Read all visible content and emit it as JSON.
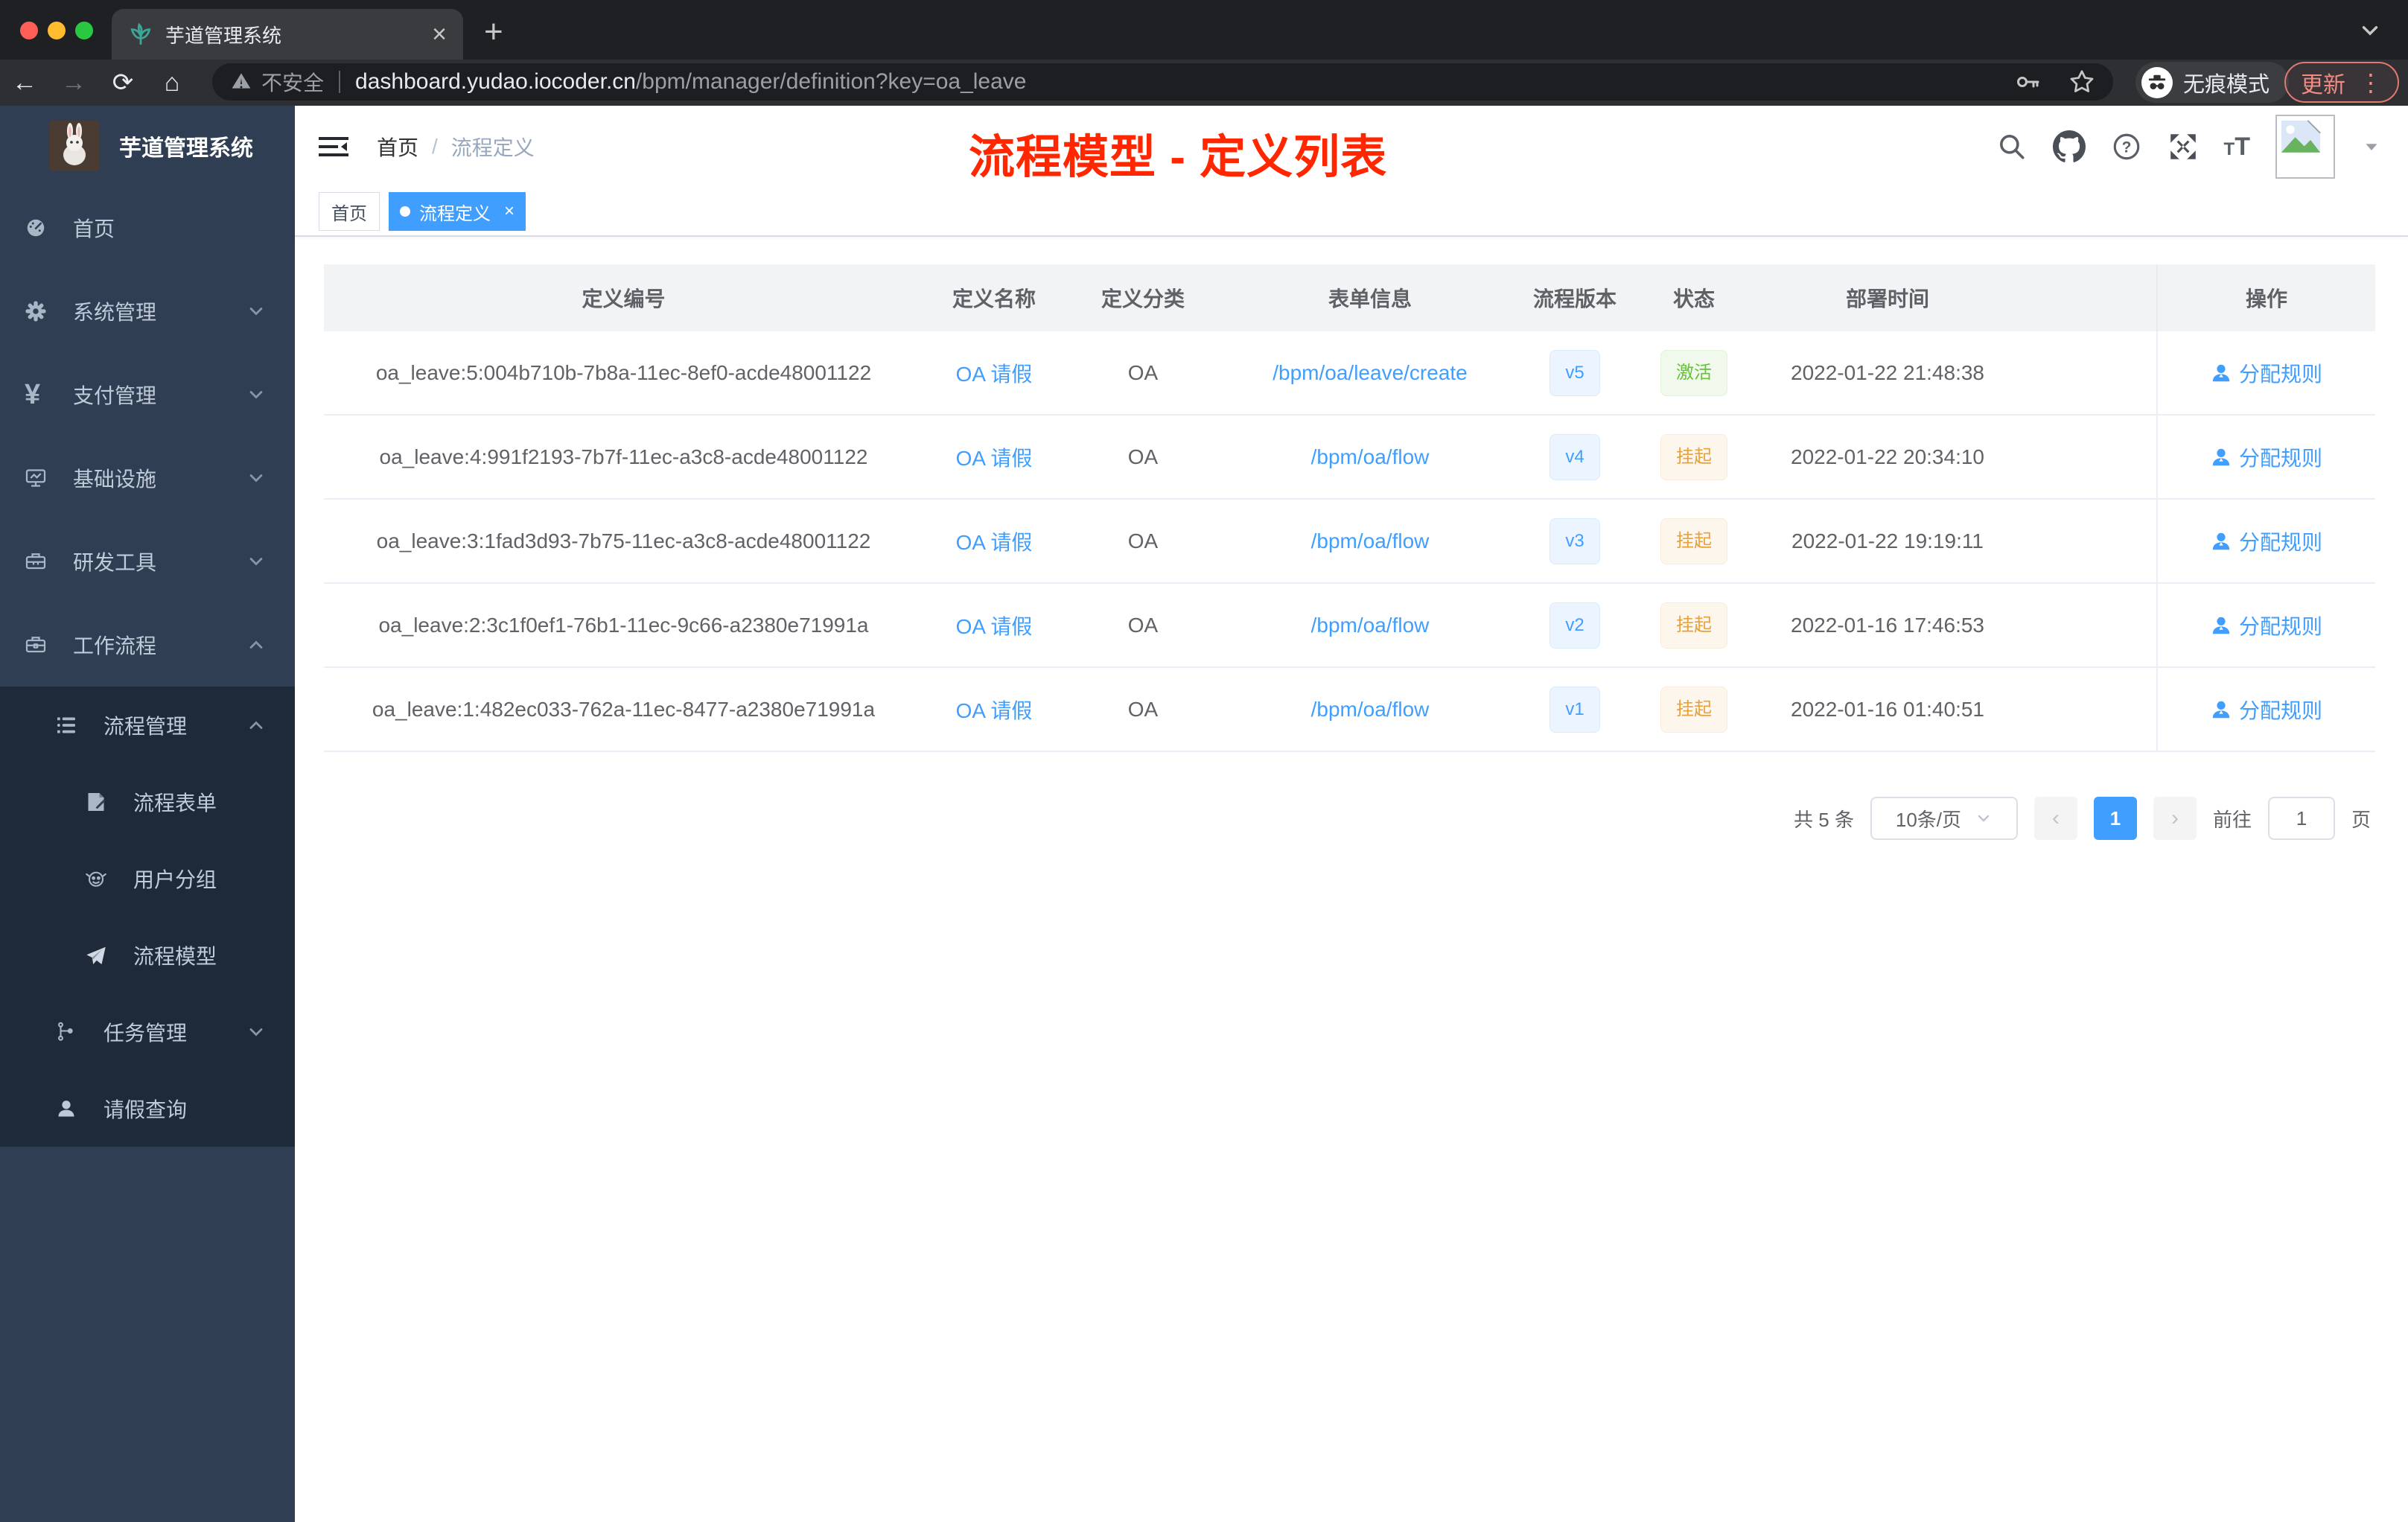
{
  "browser": {
    "tab_title": "芋道管理系统",
    "security_label": "不安全",
    "url_host": "dashboard.yudao.iocoder.cn",
    "url_path": "/bpm/manager/definition?key=oa_leave",
    "incognito_label": "无痕模式",
    "update_label": "更新"
  },
  "glyphs": {
    "close": "×",
    "plus": "+",
    "kebab": "⋮",
    "prev": "‹",
    "next": "›",
    "slash": "/",
    "question": "?",
    "tt_small": "T",
    "tt_big": "T"
  },
  "annotation": {
    "text": "流程模型 - 定义列表",
    "color": "#ff2600"
  },
  "sidebar": {
    "title": "芋道管理系统",
    "items": [
      {
        "label": "首页",
        "icon": "dashboard-icon"
      },
      {
        "label": "系统管理",
        "icon": "gear-icon"
      },
      {
        "label": "支付管理",
        "icon": "yen-icon"
      },
      {
        "label": "基础设施",
        "icon": "monitor-icon"
      },
      {
        "label": "研发工具",
        "icon": "toolbox-icon"
      },
      {
        "label": "工作流程",
        "icon": "briefcase-icon"
      }
    ],
    "submenu": [
      {
        "label": "流程管理",
        "icon": "list-icon"
      },
      {
        "label": "流程表单",
        "icon": "form-icon"
      },
      {
        "label": "用户分组",
        "icon": "robot-icon"
      },
      {
        "label": "流程模型",
        "icon": "paper-plane-icon"
      },
      {
        "label": "任务管理",
        "icon": "flow-icon"
      },
      {
        "label": "请假查询",
        "icon": "user-icon"
      }
    ]
  },
  "header": {
    "breadcrumb": [
      "首页",
      "流程定义"
    ]
  },
  "tags": [
    {
      "label": "首页",
      "active": false
    },
    {
      "label": "流程定义",
      "active": true
    }
  ],
  "table": {
    "columns": [
      "定义编号",
      "定义名称",
      "定义分类",
      "表单信息",
      "流程版本",
      "状态",
      "部署时间",
      "操作"
    ],
    "rows": [
      {
        "id": "oa_leave:5:004b710b-7b8a-11ec-8ef0-acde48001122",
        "name": "OA 请假",
        "category": "OA",
        "form": "/bpm/oa/leave/create",
        "version": "v5",
        "status": "激活",
        "status_type": "success",
        "deployed": "2022-01-22 21:48:38",
        "action": "分配规则"
      },
      {
        "id": "oa_leave:4:991f2193-7b7f-11ec-a3c8-acde48001122",
        "name": "OA 请假",
        "category": "OA",
        "form": "/bpm/oa/flow",
        "version": "v4",
        "status": "挂起",
        "status_type": "warning",
        "deployed": "2022-01-22 20:34:10",
        "action": "分配规则"
      },
      {
        "id": "oa_leave:3:1fad3d93-7b75-11ec-a3c8-acde48001122",
        "name": "OA 请假",
        "category": "OA",
        "form": "/bpm/oa/flow",
        "version": "v3",
        "status": "挂起",
        "status_type": "warning",
        "deployed": "2022-01-22 19:19:11",
        "action": "分配规则"
      },
      {
        "id": "oa_leave:2:3c1f0ef1-76b1-11ec-9c66-a2380e71991a",
        "name": "OA 请假",
        "category": "OA",
        "form": "/bpm/oa/flow",
        "version": "v2",
        "status": "挂起",
        "status_type": "warning",
        "deployed": "2022-01-16 17:46:53",
        "action": "分配规则"
      },
      {
        "id": "oa_leave:1:482ec033-762a-11ec-8477-a2380e71991a",
        "name": "OA 请假",
        "category": "OA",
        "form": "/bpm/oa/flow",
        "version": "v1",
        "status": "挂起",
        "status_type": "warning",
        "deployed": "2022-01-16 01:40:51",
        "action": "分配规则"
      }
    ]
  },
  "pagination": {
    "total_label": "共 5 条",
    "page_size": "10条/页",
    "current_page": "1",
    "goto_label": "前往",
    "goto_value": "1",
    "page_unit": "页"
  },
  "colors": {
    "accent": "#409eff",
    "sidebar_bg": "#2f3e52",
    "submenu_bg": "#1e2a39",
    "success": "#67c23a",
    "warning": "#e6a23c",
    "annotation_red": "#ff2600"
  }
}
